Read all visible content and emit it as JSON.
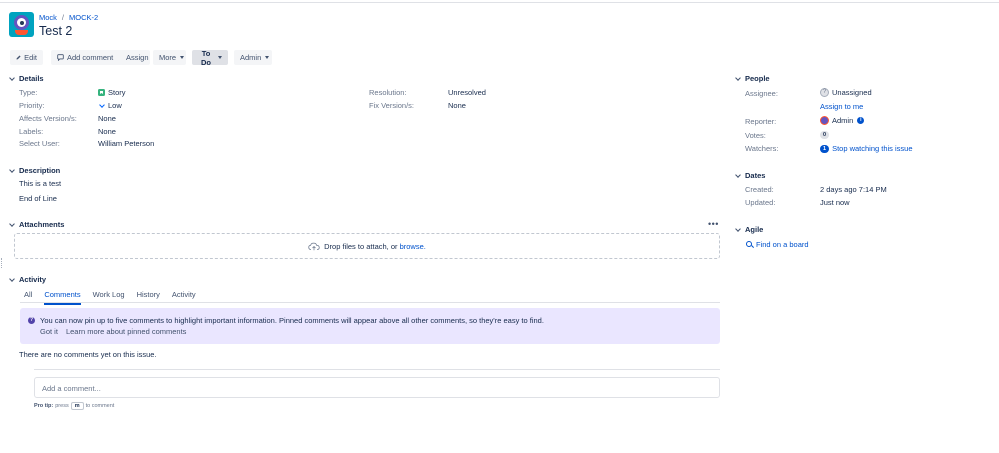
{
  "breadcrumb": {
    "project": "Mock",
    "issue_key": "MOCK-2"
  },
  "issue": {
    "title": "Test 2"
  },
  "toolbar": {
    "edit": "Edit",
    "add_comment": "Add comment",
    "assign": "Assign",
    "more": "More",
    "status": "To Do",
    "admin": "Admin"
  },
  "details": {
    "heading": "Details",
    "type_label": "Type:",
    "type_value": "Story",
    "priority_label": "Priority:",
    "priority_value": "Low",
    "affects_label": "Affects Version/s:",
    "affects_value": "None",
    "labels_label": "Labels:",
    "labels_value": "None",
    "select_user_label": "Select User:",
    "select_user_value": "William Peterson",
    "resolution_label": "Resolution:",
    "resolution_value": "Unresolved",
    "fix_label": "Fix Version/s:",
    "fix_value": "None"
  },
  "description": {
    "heading": "Description",
    "line1": "This is a test",
    "line2": "End of Line"
  },
  "attachments": {
    "heading": "Attachments",
    "more": "•••",
    "drop_text": "Drop files to attach, or",
    "browse": "browse."
  },
  "activity": {
    "heading": "Activity",
    "tabs": [
      "All",
      "Comments",
      "Work Log",
      "History",
      "Activity"
    ],
    "info_text": "You can now pin up to five comments to highlight important information. Pinned comments will appear above all other comments, so they're easy to find.",
    "got_it": "Got it",
    "learn_more": "Learn more about pinned comments",
    "empty": "There are no comments yet on this issue.",
    "comment_placeholder": "Add a comment...",
    "protip_label": "Pro tip:",
    "protip_press": "press",
    "protip_key": "m",
    "protip_suffix": "to comment"
  },
  "people": {
    "heading": "People",
    "assignee_label": "Assignee:",
    "assignee_value": "Unassigned",
    "assign_to_me": "Assign to me",
    "reporter_label": "Reporter:",
    "reporter_value": "Admin",
    "votes_label": "Votes:",
    "votes_value": "0",
    "watchers_label": "Watchers:",
    "watchers_count": "1",
    "watch_link": "Stop watching this issue"
  },
  "dates": {
    "heading": "Dates",
    "created_label": "Created:",
    "created_value": "2 days ago 7:14 PM",
    "updated_label": "Updated:",
    "updated_value": "Just now"
  },
  "agile": {
    "heading": "Agile",
    "find_board": "Find on a board"
  },
  "colors": {
    "link": "#0052cc",
    "story": "#36b37e",
    "info_panel": "#eae6ff",
    "project_avatar": "#00a3bf"
  }
}
